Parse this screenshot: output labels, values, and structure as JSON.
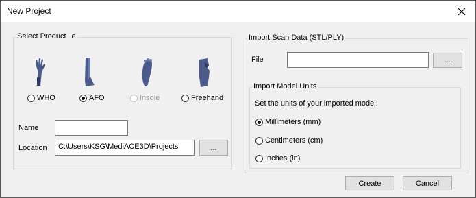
{
  "window": {
    "title": "New Project"
  },
  "select_product": {
    "legend": "Select Product",
    "legend_suffix": "e",
    "options": [
      {
        "label": "WHO",
        "selected": false,
        "disabled": false,
        "icon": "hand-orthosis-icon"
      },
      {
        "label": "AFO",
        "selected": true,
        "disabled": false,
        "icon": "leg-orthosis-icon"
      },
      {
        "label": "Insole",
        "selected": false,
        "disabled": true,
        "icon": "foot-insole-icon"
      },
      {
        "label": "Freehand",
        "selected": false,
        "disabled": false,
        "icon": "freehand-shape-icon"
      }
    ],
    "name_label": "Name",
    "name_value": "",
    "location_label": "Location",
    "location_value": "C:\\Users\\KSG\\MediACE3D\\Projects",
    "browse_label": "..."
  },
  "import_scan": {
    "legend": "Import Scan Data (STL/PLY)",
    "file_label": "File",
    "file_value": "",
    "browse_label": "...",
    "units": {
      "legend": "Import Model Units",
      "prompt": "Set the units of your imported model:",
      "options": [
        {
          "label": "Millimeters (mm)",
          "selected": true
        },
        {
          "label": "Centimeters (cm)",
          "selected": false
        },
        {
          "label": "Inches (in)",
          "selected": false
        }
      ]
    }
  },
  "footer": {
    "create_label": "Create",
    "cancel_label": "Cancel"
  },
  "colors": {
    "window_bg": "#f0f0f0",
    "icon_fill": "#4a5a8a",
    "disabled_text": "#a0a0a0"
  }
}
